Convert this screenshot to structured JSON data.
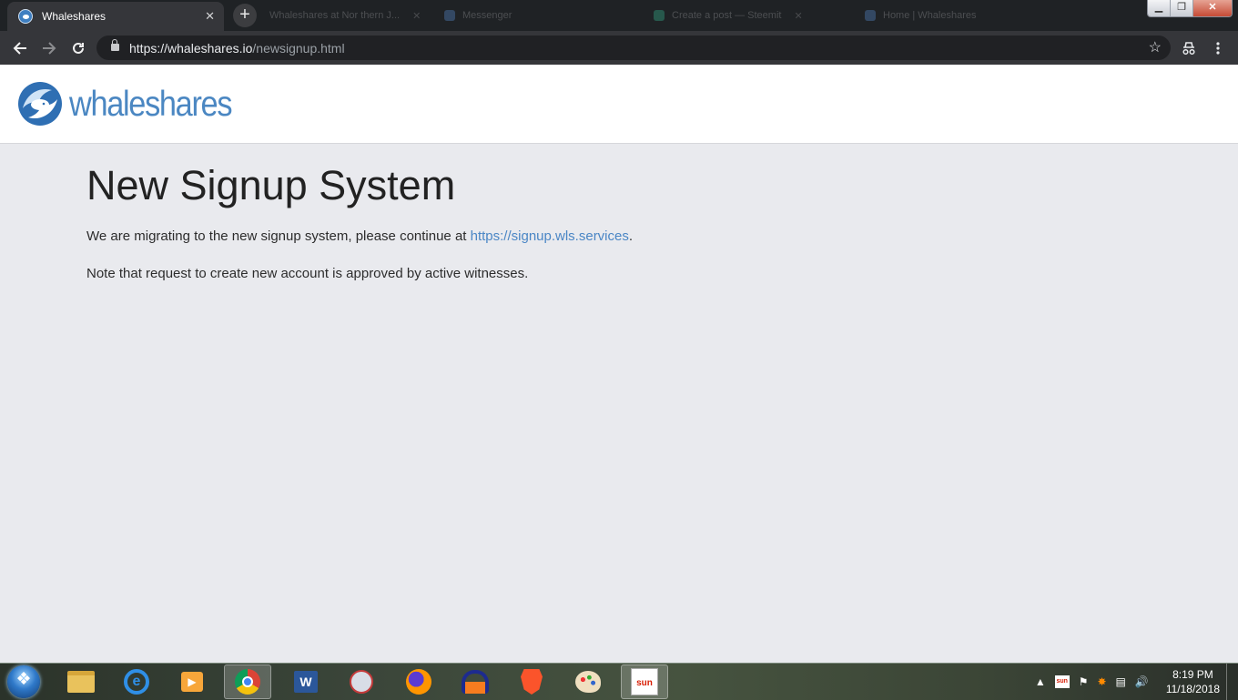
{
  "browser": {
    "active_tab_title": "Whaleshares",
    "background_tabs": [
      "Whaleshares at Nor thern J...",
      "Messenger",
      "Create a post — Steemit",
      "Home | Whaleshares"
    ],
    "url_host": "https://whaleshares.io",
    "url_path": "/newsignup.html"
  },
  "site": {
    "logo_text": "whaleshares",
    "brand_color": "#4b87c2"
  },
  "content": {
    "title": "New Signup System",
    "p1_before": "We are migrating to the new signup system, please continue at ",
    "p1_link": "https://signup.wls.services",
    "p1_after": ".",
    "p2": "Note that request to create new account is approved by active witnesses."
  },
  "taskbar": {
    "apps": [
      "folder-icon",
      "ie-icon",
      "media-player-icon",
      "chrome-icon",
      "word-icon",
      "snipping-tool-icon",
      "firefox-icon",
      "audacity-icon",
      "brave-icon",
      "paint-icon",
      "sun-broadband-icon"
    ],
    "active_app": "chrome-icon",
    "sun_label": "sun",
    "word_label": "W",
    "clock_time": "8:19 PM",
    "clock_date": "11/18/2018"
  }
}
